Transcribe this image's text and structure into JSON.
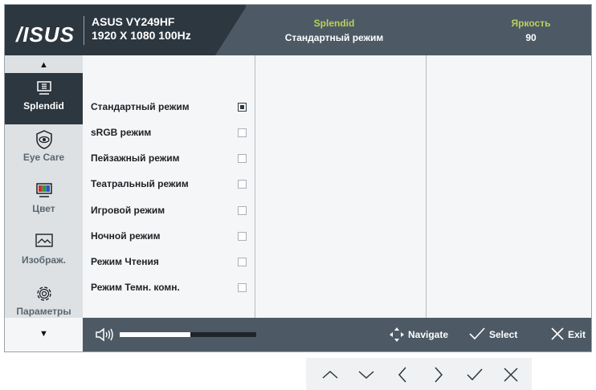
{
  "header": {
    "logo": "/ISUS",
    "model": "ASUS VY249HF",
    "resolution": "1920 X 1080 100Hz",
    "mode_label": "Splendid",
    "mode_value": "Стандартный режим",
    "brightness_label": "Яркость",
    "brightness_value": "90"
  },
  "sidebar": {
    "items": [
      {
        "label": "Splendid",
        "icon": "monitor-icon",
        "active": true
      },
      {
        "label": "Eye Care",
        "icon": "eye-icon"
      },
      {
        "label": "Цвет",
        "icon": "color-icon"
      },
      {
        "label": "Изображ.",
        "icon": "image-icon"
      },
      {
        "label": "Параметры",
        "icon": "gear-icon"
      }
    ]
  },
  "options": [
    {
      "label": "Стандартный режим",
      "selected": true
    },
    {
      "label": "sRGB режим"
    },
    {
      "label": "Пейзажный режим"
    },
    {
      "label": "Театральный режим"
    },
    {
      "label": "Игровой режим"
    },
    {
      "label": "Ночной режим"
    },
    {
      "label": "Режим Чтения"
    },
    {
      "label": "Режим Темн. комн."
    }
  ],
  "footer": {
    "volume_fraction": 0.52,
    "navigate": "Navigate",
    "select": "Select",
    "exit": "Exit"
  },
  "colors": {
    "header_dark": "#2c3740",
    "header_mid": "#4d5a65",
    "accent": "#b9d15c"
  }
}
